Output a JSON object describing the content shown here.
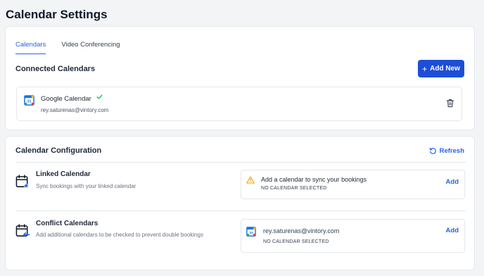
{
  "page": {
    "title": "Calendar Settings"
  },
  "tabs": [
    {
      "label": "Calendars",
      "active": true
    },
    {
      "label": "Video Conferencing",
      "active": false
    }
  ],
  "connected": {
    "title": "Connected Calendars",
    "add_button_label": "Add New",
    "items": [
      {
        "name": "Google Calendar",
        "email": "rey.saturenas@vintory.com",
        "icon": "google-calendar-icon",
        "verified": true
      }
    ]
  },
  "config": {
    "title": "Calendar Configuration",
    "refresh_label": "Refresh",
    "linked": {
      "title": "Linked Calendar",
      "description": "Sync bookings with your linked calendar",
      "status_text": "Add a calendar to sync your bookings",
      "status_sub": "NO CALENDAR SELECTED",
      "add_label": "Add"
    },
    "conflict": {
      "title": "Conflict Calendars",
      "description": "Add additional calendars to be checked to prevent double bookings",
      "email": "rey.saturenas@vintory.com",
      "status_sub": "NO CALENDAR SELECTED",
      "add_label": "Add"
    }
  },
  "colors": {
    "accent": "#2563eb",
    "button_bg": "#1d4ed8",
    "warning": "#f59e0b",
    "success": "#22c55e"
  }
}
